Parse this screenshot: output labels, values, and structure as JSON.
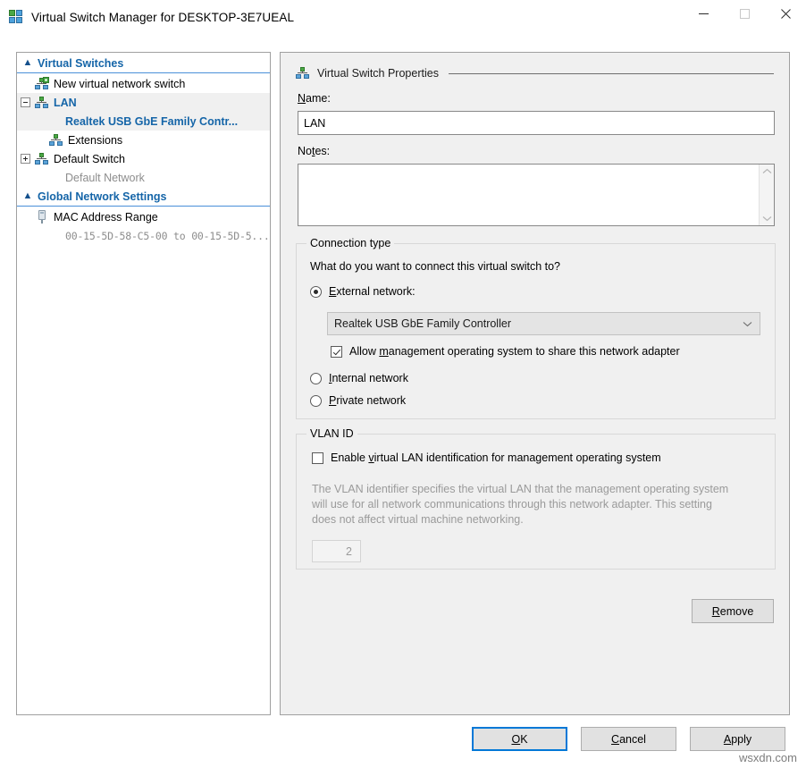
{
  "window": {
    "title": "Virtual Switch Manager for DESKTOP-3E7UEAL",
    "icon": "virtual-switch-manager-icon",
    "minimize_label": "Minimize",
    "maximize_label": "Maximize",
    "close_label": "Close"
  },
  "tree": {
    "sections": [
      {
        "header": "Virtual Switches",
        "chevron": "chevron-up-double",
        "items": [
          {
            "label": "New virtual network switch",
            "icon": "new-virtual-switch-icon",
            "expander": "none",
            "selected": false
          },
          {
            "label": "LAN",
            "icon": "virtual-switch-icon",
            "expander": "minus",
            "selected": true,
            "sub": "Realtek USB GbE Family Contr...",
            "sub_style": "blue-bold"
          },
          {
            "label": "Extensions",
            "icon": "virtual-switch-icon",
            "expander": "none",
            "indent": true,
            "selected": false
          },
          {
            "label": "Default Switch",
            "icon": "virtual-switch-icon",
            "expander": "plus",
            "selected": false,
            "sub": "Default Network",
            "sub_style": "gray"
          }
        ]
      },
      {
        "header": "Global Network Settings",
        "chevron": "chevron-up-double",
        "items": [
          {
            "label": "MAC Address Range",
            "icon": "mac-address-icon",
            "expander": "none",
            "selected": false,
            "sub": "00-15-5D-58-C5-00 to 00-15-5D-5...",
            "sub_style": "mono"
          }
        ]
      }
    ]
  },
  "properties": {
    "section_title": "Virtual Switch Properties",
    "name_label": "Name:",
    "name_accesskey": "N",
    "name_value": "LAN",
    "notes_label": "Notes:",
    "notes_accesskey": "t",
    "notes_value": "",
    "connection": {
      "legend": "Connection type",
      "question": "What do you want to connect this virtual switch to?",
      "options": [
        {
          "label": "External network:",
          "accesskey": "E",
          "selected": true
        },
        {
          "label": "Internal network",
          "accesskey": "I",
          "selected": false
        },
        {
          "label": "Private network",
          "accesskey": "P",
          "selected": false
        }
      ],
      "adapter_selected": "Realtek USB GbE Family Controller",
      "share_label_pre": "Allow ",
      "share_accesskey": "m",
      "share_label_post": "anagement operating system to share this network adapter",
      "share_checked": true
    },
    "vlan": {
      "legend": "VLAN ID",
      "enable_label_pre": "Enable ",
      "enable_accesskey": "v",
      "enable_label_post": "irtual LAN identification for management operating system",
      "enable_checked": false,
      "description": "The VLAN identifier specifies the virtual LAN that the management operating system will use for all network communications through this network adapter. This setting does not affect virtual machine networking.",
      "id_value": "2"
    },
    "remove_button": "Remove",
    "remove_accesskey": "R"
  },
  "footer": {
    "ok": "OK",
    "ok_accesskey": "O",
    "cancel": "Cancel",
    "cancel_accesskey": "C",
    "apply": "Apply",
    "apply_accesskey": "A"
  },
  "watermark": "wsxdn.com",
  "colors": {
    "accent_blue": "#1565a8",
    "header_rule": "#4a90d9",
    "panel_bg": "#f0f0f0",
    "focus_blue": "#0078d7",
    "disabled_gray": "#9a9a9a"
  }
}
